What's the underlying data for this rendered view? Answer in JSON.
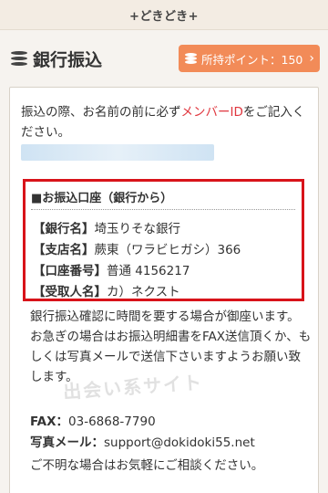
{
  "site": {
    "name": "+どきどき+"
  },
  "header": {
    "title": "銀行振込"
  },
  "points": {
    "label": "所持ポイント：150",
    "chevron": "›"
  },
  "intro": {
    "text_before": "振込の際、お名前の前に必ず",
    "accent": "メンバーID",
    "text_after": "をご記入ください。"
  },
  "account": {
    "heading": "■お振込口座（銀行から）",
    "rows": [
      {
        "label": "【銀行名】",
        "value": "埼玉りそな銀行"
      },
      {
        "label": "【支店名】",
        "value": "蕨東（ワラビヒガシ）366"
      },
      {
        "label": "【口座番号】",
        "value": "普通 4156217"
      },
      {
        "label": "【受取人名】",
        "value": "カ）ネクスト"
      }
    ]
  },
  "notes": {
    "line1": "銀行振込確認に時間を要する場合が御座います。",
    "line2": "お急ぎの場合はお振込明細書をFAX送信頂くか、もしくは写真メールで送信下さいますようお願い致します。"
  },
  "watermark": "出会い系サイト",
  "contact": {
    "fax_label": "FAX：",
    "fax_value": "03-6868-7790",
    "mail_label": "写真メール：",
    "mail_value": "support@dokidoki55.net"
  },
  "outro": "ご不明な場合はお気軽にご相談ください。"
}
